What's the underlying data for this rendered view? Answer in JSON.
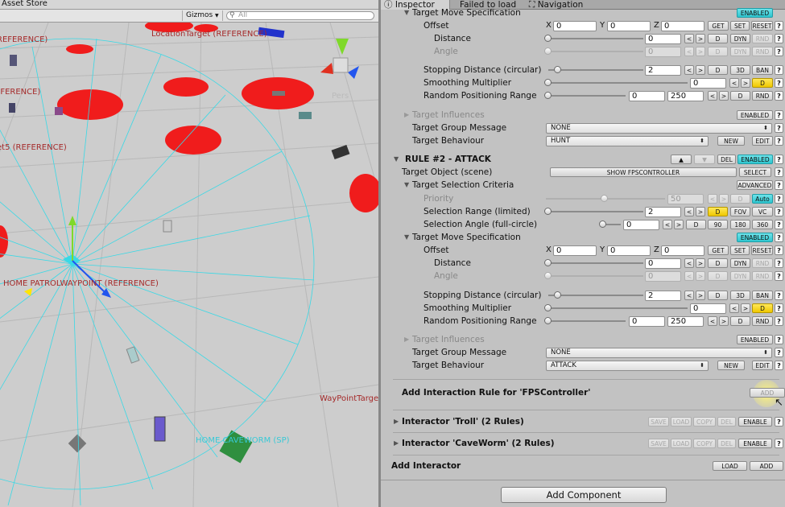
{
  "scene": {
    "tab_label": "Asset Store",
    "gizmos_label": "Gizmos",
    "search_placeholder": "All",
    "labels": [
      "REFERENCE)",
      "LocationTarget (REFERENCE)",
      "EFERENCE)",
      "Pers",
      "et5 (REFERENCE)",
      "HOME  PATROLWAYPOINT (REFERENCE)",
      "WayPointTarge",
      "HOME  CAVEWORM (SP)"
    ]
  },
  "inspector": {
    "tabs": [
      {
        "label": "Inspector",
        "icon": "info-icon"
      },
      {
        "label": "Failed to load",
        "icon": ""
      },
      {
        "label": "Navigation",
        "icon": "navigation-icon"
      }
    ],
    "move_spec_1": {
      "title": "Target Move Specification",
      "enabled": "ENABLED",
      "offset_label": "Offset",
      "x": "0",
      "y": "0",
      "z": "0",
      "get": "GET",
      "set": "SET",
      "reset": "RESET",
      "distance_label": "Distance",
      "distance_value": "0",
      "angle_label": "Angle",
      "angle_value": "0",
      "stop_label": "Stopping Distance (circular)",
      "stop_value": "2",
      "smooth_label": "Smoothing Multiplier",
      "smooth_value": "0",
      "random_label": "Random Positioning Range",
      "random_min": "0",
      "random_max": "250"
    },
    "influences_1": "Target Influences",
    "group_msg_label_1": "Target Group Message",
    "group_msg_value_1": "NONE",
    "behaviour_label_1": "Target Behaviour",
    "behaviour_value_1": "HUNT",
    "rule2": {
      "title": "RULE #2 - ATTACK",
      "up": "▲",
      "down": "▼",
      "del": "DEL",
      "enabled": "ENABLED",
      "target_object_label": "Target Object (scene)",
      "target_object_value": "SHOW FPSCONTROLLER",
      "select": "SELECT",
      "criteria_title": "Target Selection Criteria",
      "advanced": "ADVANCED",
      "priority_label": "Priority",
      "priority_value": "50",
      "auto": "Auto",
      "range_label": "Selection Range (limited)",
      "range_value": "2",
      "fov": "FOV",
      "vc": "VC",
      "angle_label": "Selection Angle (full-circle)",
      "angle_value": "0",
      "a90": "90",
      "a180": "180",
      "a360": "360"
    },
    "move_spec_2": {
      "title": "Target Move Specification",
      "enabled": "ENABLED",
      "offset_label": "Offset",
      "x": "0",
      "y": "0",
      "z": "0",
      "get": "GET",
      "set": "SET",
      "reset": "RESET",
      "distance_label": "Distance",
      "distance_value": "0",
      "angle_label": "Angle",
      "angle_value": "0",
      "stop_label": "Stopping Distance (circular)",
      "stop_value": "2",
      "smooth_label": "Smoothing Multiplier",
      "smooth_value": "0",
      "random_label": "Random Positioning Range",
      "random_min": "0",
      "random_max": "250"
    },
    "influences_2": "Target Influences",
    "group_msg_label_2": "Target Group Message",
    "group_msg_value_2": "NONE",
    "behaviour_label_2": "Target Behaviour",
    "behaviour_value_2": "ATTACK",
    "btn_common": {
      "lt": "<",
      "gt": ">",
      "d": "D",
      "dyn": "DYN",
      "rnd": "RND",
      "three_d": "3D",
      "ban": "BAN",
      "new": "NEW",
      "edit": "EDIT",
      "q": "?"
    },
    "add_rule_label": "Add Interaction Rule for 'FPSController'",
    "add_rule_btn": "ADD",
    "interactors": [
      {
        "label": "Interactor 'Troll' (2 Rules)",
        "save": "SAVE",
        "load": "LOAD",
        "copy": "COPY",
        "del": "DEL",
        "enable": "ENABLE"
      },
      {
        "label": "Interactor 'CaveWorm' (2 Rules)",
        "save": "SAVE",
        "load": "LOAD",
        "copy": "COPY",
        "del": "DEL",
        "enable": "ENABLE"
      }
    ],
    "add_interactor_label": "Add Interactor",
    "add_interactor_load": "LOAD",
    "add_interactor_add": "ADD",
    "add_component": "Add Component"
  },
  "colors": {
    "enabled": "#2ec5cf",
    "highlight": "#f0c800",
    "target_red": "#f01c1c",
    "gizmo_cyan": "#38d9e6"
  }
}
